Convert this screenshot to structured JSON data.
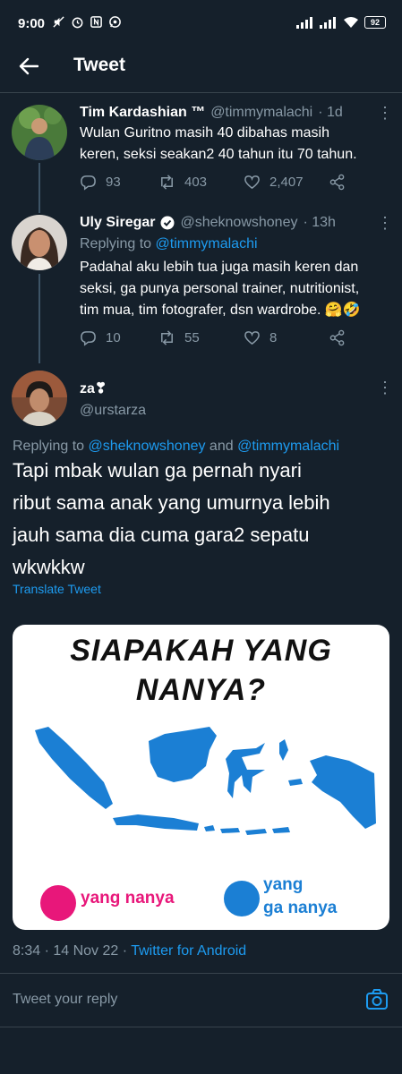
{
  "status_bar": {
    "time": "9:00",
    "battery": "92"
  },
  "header": {
    "title": "Tweet"
  },
  "tweets": [
    {
      "name": "Tim Kardashian ™",
      "handle": "@timmymalachi",
      "time": "· 1d",
      "text_lines": [
        "Wulan Guritno masih 40 dibahas masih",
        "keren, seksi seakan2 40 tahun itu 70 tahun."
      ],
      "replies": "93",
      "retweets": "403",
      "likes": "2,407"
    },
    {
      "name": "Uly Siregar",
      "handle": "@sheknowshoney",
      "time": "· 13h",
      "replying_prefix": "Replying to ",
      "replying_to": "@timmymalachi",
      "text_lines": [
        "Padahal aku lebih tua juga masih keren dan",
        "seksi, ga punya personal trainer, nutritionist,",
        "tim mua, tim fotografer, dsn wardrobe. 🤗🤣"
      ],
      "replies": "10",
      "retweets": "55",
      "likes": "8"
    }
  ],
  "main_tweet": {
    "name": "za❣",
    "handle": "@urstarza",
    "replying_prefix": "Replying to ",
    "replying_user1": "@sheknowshoney",
    "replying_and": " and ",
    "replying_user2": "@timmymalachi",
    "text_lines": [
      "Tapi mbak wulan ga pernah nyari",
      "ribut sama anak yang umurnya lebih",
      "jauh sama dia cuma gara2 sepatu",
      "wkwkkw"
    ],
    "translate": "Translate Tweet",
    "image": {
      "title_line1": "SIAPAKAH YANG",
      "title_line2": "NANYA?",
      "legend1": "yang nanya",
      "legend2_line1": "yang",
      "legend2_line2": "ga nanya",
      "color1": "#e8177a",
      "color2": "#1b7fd4"
    },
    "timestamp": "8:34 · 14 Nov 22 · ",
    "source": "Twitter for Android"
  },
  "reply_box": {
    "placeholder": "Tweet your reply"
  },
  "colors": {
    "background": "#15202b",
    "accent": "#1d9bf0",
    "muted": "#8899a6"
  }
}
